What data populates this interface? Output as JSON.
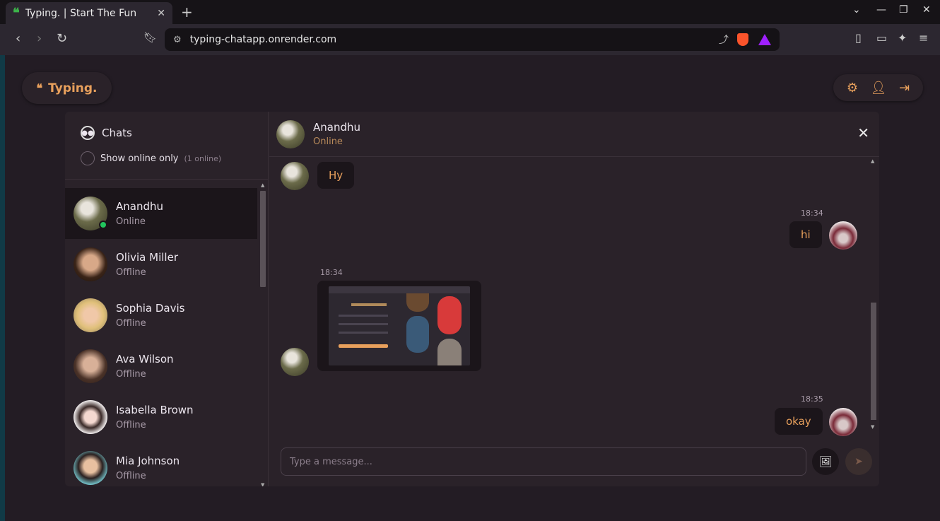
{
  "browser": {
    "tab_title": "Typing. | Start The Fun",
    "tab_icon": "quote-icon",
    "url": "typing-chatapp.onrender.com"
  },
  "app": {
    "logo_text": "Typing.",
    "accent_color": "#e8a05c"
  },
  "sidebar": {
    "title": "Chats",
    "online_filter_label": "Show online only",
    "online_count": "(1 online)",
    "contacts": [
      {
        "name": "Anandhu",
        "status": "Online",
        "active": true
      },
      {
        "name": "Olivia Miller",
        "status": "Offline"
      },
      {
        "name": "Sophia Davis",
        "status": "Offline"
      },
      {
        "name": "Ava Wilson",
        "status": "Offline"
      },
      {
        "name": "Isabella Brown",
        "status": "Offline"
      },
      {
        "name": "Mia Johnson",
        "status": "Offline"
      }
    ]
  },
  "chat": {
    "name": "Anandhu",
    "status": "Online",
    "messages": [
      {
        "from": "them",
        "text": "Hy"
      },
      {
        "from": "me",
        "time": "18:34",
        "text": "hi"
      },
      {
        "from": "them",
        "time": "18:34",
        "image": true
      },
      {
        "from": "me",
        "time": "18:35",
        "text": "okay"
      }
    ],
    "composer_placeholder": "Type a message..."
  }
}
